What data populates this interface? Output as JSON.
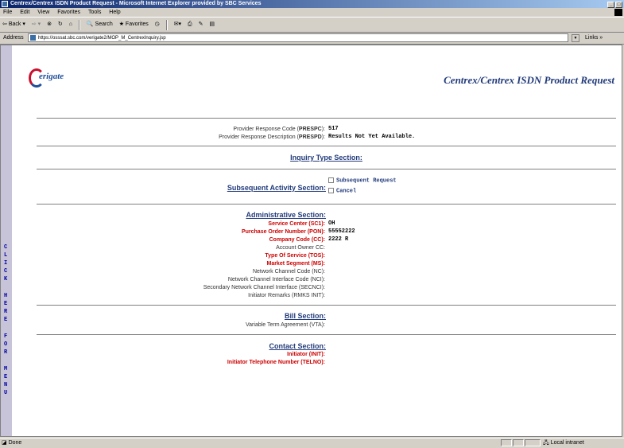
{
  "window": {
    "title": "Centrex/Centrex ISDN Product Request - Microsoft Internet Explorer provided by SBC Services"
  },
  "menu": [
    "File",
    "Edit",
    "View",
    "Favorites",
    "Tools",
    "Help"
  ],
  "toolbar": {
    "back": "Back",
    "search": "Search",
    "favorites": "Favorites"
  },
  "address": {
    "label": "Address",
    "url": "https://osssat.sbc.com/verigate2/MOP_M_CentrexInquiry.jsp",
    "links": "Links »"
  },
  "sidebar": {
    "text": "CLICK HERE FOR MENU"
  },
  "logo": {
    "text": "erigate"
  },
  "page": {
    "title": "Centrex/Centrex ISDN Product Request"
  },
  "response": {
    "code_label": "Provider Response Code (",
    "code_abbr": "PRESPC",
    "code_value": "517",
    "desc_label": "Provider Response Description (",
    "desc_abbr": "PRESPD",
    "desc_value": "Results Not Yet Available."
  },
  "sections": {
    "inquiry_type": "Inquiry Type Section:",
    "subsequent_activity": "Subsequent Activity Section:",
    "administrative": "Administrative Section:",
    "bill": "Bill Section:",
    "contact": "Contact Section:"
  },
  "subsequent": {
    "option1": "Subsequent Request",
    "option2": "Cancel"
  },
  "admin": {
    "sc_label": "Service Center (SC1):",
    "sc_value": "OH",
    "pon_label": "Purchase Order Number (PON):",
    "pon_value": "55552222",
    "cc_label": "Company Code (CC):",
    "cc_value": "2222 R",
    "aocc_label": "Account Owner CC:",
    "tos_label": "Type Of Service (TOS):",
    "ms_label": "Market Segment (MS):",
    "nc_label": "Network Channel Code (NC):",
    "nci_label": "Network Channel Interface Code (NCI):",
    "secnci_label": "Secondary Network Channel Interface (SECNCI):",
    "rmks_label": "Initiator Remarks (RMKS INIT):"
  },
  "bill": {
    "vta_label": "Variable Term Agreement (VTA):"
  },
  "contact": {
    "init_label": "Initiator (INIT):",
    "telno_label": "Initiator Telephone Number (TELNO):"
  },
  "status": {
    "text": "Done",
    "zone": "Local intranet"
  }
}
